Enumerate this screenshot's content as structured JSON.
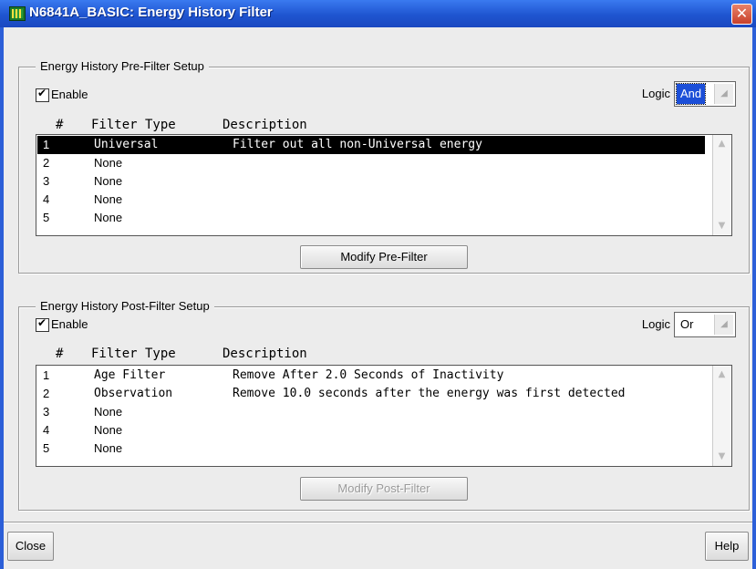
{
  "window": {
    "title": "N6841A_BASIC: Energy History Filter",
    "close_glyph": "✕"
  },
  "pre_filter": {
    "group_title": "Energy History Pre-Filter Setup",
    "enable_label": "Enable",
    "enable_checked": true,
    "logic_label": "Logic",
    "logic_value": "And",
    "headers": {
      "num": "#",
      "type": "Filter Type",
      "desc": "Description"
    },
    "rows": [
      {
        "num": "1",
        "type": "Universal",
        "desc": "Filter out all non-Universal energy",
        "selected": true
      },
      {
        "num": "2",
        "type": "None",
        "desc": ""
      },
      {
        "num": "3",
        "type": "None",
        "desc": ""
      },
      {
        "num": "4",
        "type": "None",
        "desc": ""
      },
      {
        "num": "5",
        "type": "None",
        "desc": ""
      }
    ],
    "modify_button": "Modify Pre-Filter"
  },
  "post_filter": {
    "group_title": "Energy History Post-Filter Setup",
    "enable_label": "Enable",
    "enable_checked": true,
    "logic_label": "Logic",
    "logic_value": "Or",
    "headers": {
      "num": "#",
      "type": "Filter Type",
      "desc": "Description"
    },
    "rows": [
      {
        "num": "1",
        "type": "Age Filter",
        "desc": "Remove After 2.0 Seconds of Inactivity"
      },
      {
        "num": "2",
        "type": "Observation",
        "desc": "Remove 10.0 seconds after the energy was first detected"
      },
      {
        "num": "3",
        "type": "None",
        "desc": ""
      },
      {
        "num": "4",
        "type": "None",
        "desc": ""
      },
      {
        "num": "5",
        "type": "None",
        "desc": ""
      }
    ],
    "modify_button": "Modify Post-Filter",
    "modify_disabled": true
  },
  "footer": {
    "close_button": "Close",
    "help_button": "Help"
  },
  "colors": {
    "titlebar": "#1f55d0",
    "selection": "#000000",
    "logic_highlight": "#1c4fd8"
  }
}
